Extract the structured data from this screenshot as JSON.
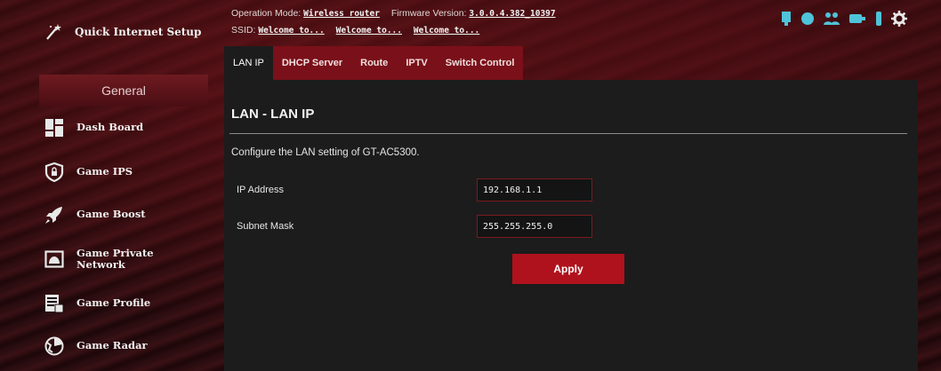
{
  "sidebar": {
    "quick_setup_label": "Quick Internet Setup",
    "section_label": "General",
    "items": [
      {
        "label": "Dash Board",
        "icon": "dashboard-icon"
      },
      {
        "label": "Game IPS",
        "icon": "shield-icon"
      },
      {
        "label": "Game Boost",
        "icon": "rocket-icon"
      },
      {
        "label": "Game Private Network",
        "icon": "private-network-icon"
      },
      {
        "label": "Game Profile",
        "icon": "profile-icon"
      },
      {
        "label": "Game Radar",
        "icon": "radar-icon"
      }
    ]
  },
  "header": {
    "operation_mode_label": "Operation Mode:",
    "operation_mode_value": "Wireless router",
    "firmware_label": "Firmware Version:",
    "firmware_value": "3.0.0.4.382_10397",
    "ssid_label": "SSID:",
    "ssid_values": [
      "Welcome to...",
      "Welcome to...",
      "Welcome to..."
    ],
    "status_icons": [
      "network-icon",
      "globe-icon",
      "users-icon",
      "usb-icon",
      "device-icon",
      "settings-icon"
    ]
  },
  "tabs": [
    {
      "label": "LAN IP",
      "active": true
    },
    {
      "label": "DHCP Server",
      "active": false
    },
    {
      "label": "Route",
      "active": false
    },
    {
      "label": "IPTV",
      "active": false
    },
    {
      "label": "Switch Control",
      "active": false
    }
  ],
  "panel": {
    "title": "LAN - LAN IP",
    "description": "Configure the LAN setting of GT-AC5300.",
    "fields": [
      {
        "label": "IP Address",
        "value": "192.168.1.1"
      },
      {
        "label": "Subnet Mask",
        "value": "255.255.255.0"
      }
    ],
    "apply_label": "Apply"
  },
  "colors": {
    "accent": "#b0121d",
    "tab_bg": "#7a1019",
    "panel_bg": "#1c1c1c",
    "status_icon": "#4fc3d9"
  }
}
